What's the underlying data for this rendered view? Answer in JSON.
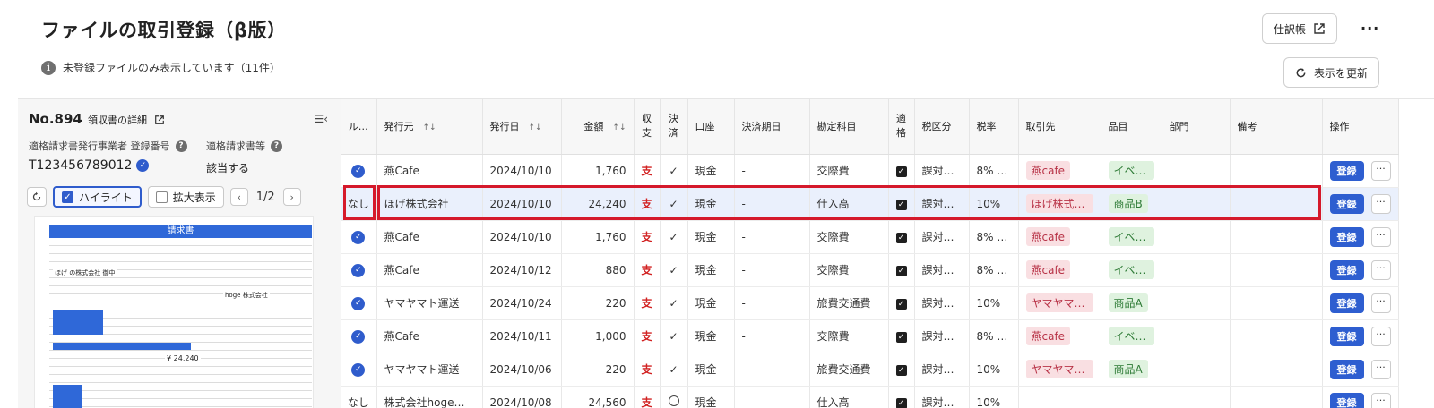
{
  "page": {
    "title": "ファイルの取引登録（β版）",
    "notice": "未登録ファイルのみ表示しています（11件）",
    "journal_button": "仕訳帳",
    "refresh_button": "表示を更新",
    "more_label": "···"
  },
  "detail": {
    "doc_no": "No.894",
    "doc_detail_label": "領収書の詳細",
    "registration_label": "適格請求書発行事業者 登録番号",
    "qualified_label": "適格請求書等",
    "registration_number": "T123456789012",
    "qualified_value": "該当する",
    "highlight_label": "ハイライト",
    "zoom_label": "拡大表示",
    "page_indicator": "1/2",
    "invoice": {
      "header": "請求書",
      "company_left": "ほげ の株式会社 御中",
      "company_right": "hoge 株式会社",
      "total": "¥ 24,240"
    }
  },
  "table": {
    "headers": {
      "rule": "ル…",
      "issuer": "発行元",
      "date": "発行日",
      "amount": "金額",
      "inout_1": "収",
      "inout_2": "支",
      "settle_1": "決",
      "settle_2": "済",
      "account": "口座",
      "due": "決済期日",
      "category": "勘定科目",
      "qual_1": "適",
      "qual_2": "格",
      "tax_class": "税区分",
      "tax_rate": "税率",
      "partner": "取引先",
      "item": "品目",
      "dept": "部門",
      "memo": "備考",
      "ops": "操作"
    },
    "register_label": "登録",
    "rows": [
      {
        "rule": "",
        "issuer": "燕Cafe",
        "date": "2024/10/10",
        "amount": "1,760",
        "inout": "支",
        "account": "現金",
        "due": "-",
        "category": "交際費",
        "tax_class": "課対仕…",
        "tax_rate": "8% (…",
        "partner": "燕cafe",
        "item": "イベン…"
      },
      {
        "rule": "なし",
        "issuer": "ほげ株式会社",
        "date": "2024/10/10",
        "amount": "24,240",
        "inout": "支",
        "account": "現金",
        "due": "-",
        "category": "仕入高",
        "tax_class": "課対仕…",
        "tax_rate": "10%",
        "partner": "ほげ株式会社",
        "item": "商品B"
      },
      {
        "rule": "",
        "issuer": "燕Cafe",
        "date": "2024/10/10",
        "amount": "1,760",
        "inout": "支",
        "account": "現金",
        "due": "-",
        "category": "交際費",
        "tax_class": "課対仕…",
        "tax_rate": "8% (…",
        "partner": "燕cafe",
        "item": "イベン…"
      },
      {
        "rule": "",
        "issuer": "燕Cafe",
        "date": "2024/10/12",
        "amount": "880",
        "inout": "支",
        "account": "現金",
        "due": "-",
        "category": "交際費",
        "tax_class": "課対仕…",
        "tax_rate": "8% (…",
        "partner": "燕cafe",
        "item": "イベン…"
      },
      {
        "rule": "",
        "issuer": "ヤマヤマト運送",
        "date": "2024/10/24",
        "amount": "220",
        "inout": "支",
        "account": "現金",
        "due": "-",
        "category": "旅費交通費",
        "tax_class": "課対仕…",
        "tax_rate": "10%",
        "partner": "ヤマヤマト…",
        "item": "商品A"
      },
      {
        "rule": "",
        "issuer": "燕Cafe",
        "date": "2024/10/11",
        "amount": "1,000",
        "inout": "支",
        "account": "現金",
        "due": "-",
        "category": "交際費",
        "tax_class": "課対仕…",
        "tax_rate": "8% (…",
        "partner": "燕cafe",
        "item": "イベン…"
      },
      {
        "rule": "",
        "issuer": "ヤマヤマト運送",
        "date": "2024/10/06",
        "amount": "220",
        "inout": "支",
        "account": "現金",
        "due": "-",
        "category": "旅費交通費",
        "tax_class": "課対仕…",
        "tax_rate": "10%",
        "partner": "ヤマヤマト…",
        "item": "商品A"
      },
      {
        "rule": "なし",
        "issuer": "株式会社hogeほげ",
        "date": "2024/10/08",
        "amount": "24,560",
        "inout": "支",
        "account": "現金",
        "due": "",
        "category": "仕入高",
        "tax_class": "課対仕…",
        "tax_rate": "10%",
        "partner": "",
        "item": ""
      }
    ]
  }
}
